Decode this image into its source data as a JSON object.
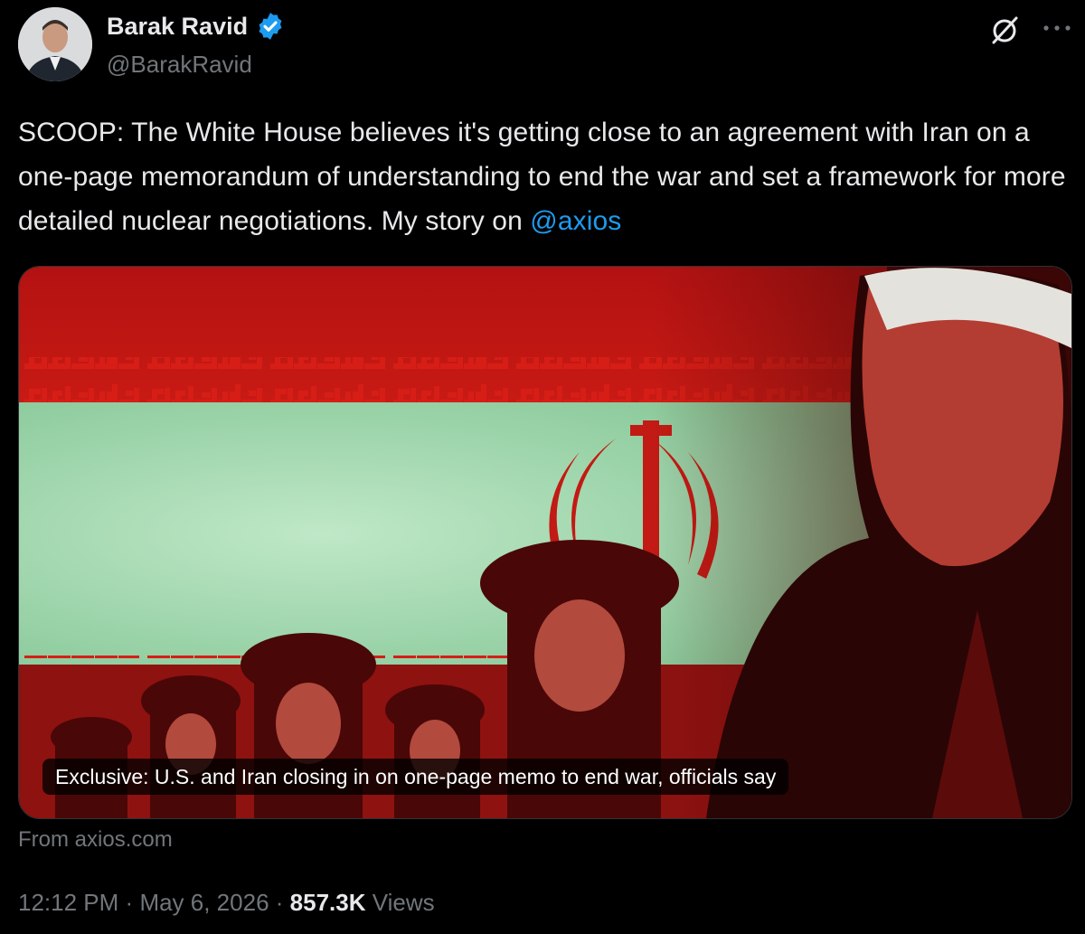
{
  "author": {
    "display_name": "Barak Ravid",
    "handle": "@BarakRavid",
    "verified": true,
    "avatar_icon": "profile-photo"
  },
  "header_icons": [
    "grok-icon",
    "more-options-icon"
  ],
  "tweet": {
    "text": "SCOOP: The White House believes it's getting close to an agreement with Iran on a one-page memorandum of understanding to end the war and set a framework for more detailed nuclear negotiations. My story on ",
    "mention": "@axios"
  },
  "link_card": {
    "caption": "Exclusive: U.S. and Iran closing in on one-page memo to end war, officials say",
    "source": "From axios.com"
  },
  "meta": {
    "time": "12:12 PM",
    "separator": "·",
    "date": "May 6, 2026",
    "views_count": "857.3K",
    "views_label": "Views"
  },
  "colors": {
    "background": "#000000",
    "text": "#e7e9ea",
    "secondary": "#71767b",
    "accent": "#1d9bf0"
  }
}
